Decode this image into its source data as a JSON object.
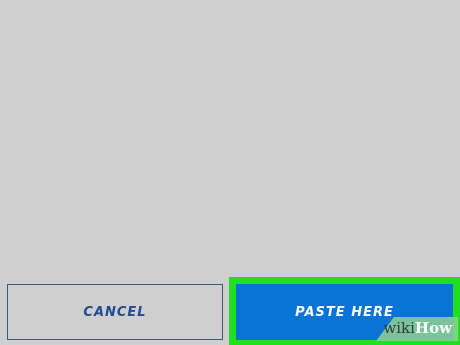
{
  "buttons": {
    "cancel_label": "CANCEL",
    "paste_label": "PASTE HERE"
  },
  "watermark": {
    "text_wiki": "wiki",
    "text_how": "How"
  },
  "colors": {
    "background": "#cfcfcf",
    "primary_button": "#0a74d6",
    "highlight_outline": "#1ee01e",
    "cancel_text": "#1f4d8f"
  }
}
